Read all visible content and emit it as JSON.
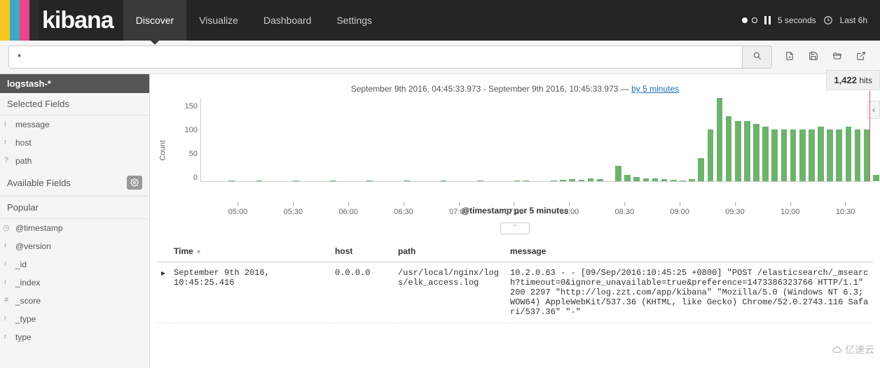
{
  "brand": "kibana",
  "nav": [
    "Discover",
    "Visualize",
    "Dashboard",
    "Settings"
  ],
  "nav_active": 0,
  "interval_label": "5 seconds",
  "timerange_label": "Last 6h",
  "search_value": "*",
  "index_pattern": "logstash-*",
  "hits_count": "1,422",
  "hits_label": "hits",
  "sidebar": {
    "selected_title": "Selected Fields",
    "selected": [
      {
        "type": "t",
        "name": "message"
      },
      {
        "type": "t",
        "name": "host"
      },
      {
        "type": "q",
        "name": "path"
      }
    ],
    "available_title": "Available Fields",
    "popular_title": "Popular",
    "popular": [
      {
        "type": "c",
        "name": "@timestamp"
      },
      {
        "type": "t",
        "name": "@version"
      },
      {
        "type": "t",
        "name": "_id"
      },
      {
        "type": "t",
        "name": "_index"
      },
      {
        "type": "h",
        "name": "_score"
      },
      {
        "type": "t",
        "name": "_type"
      },
      {
        "type": "t",
        "name": "type"
      }
    ]
  },
  "range_from": "September 9th 2016, 04:45:33.973",
  "range_to": "September 9th 2016, 10:45:33.973",
  "range_sep": " - ",
  "range_dash": " — ",
  "range_link": "by 5 minutes",
  "chart_data": {
    "type": "bar",
    "title": "",
    "xlabel": "@timestamp per 5 minutes",
    "ylabel": "Count",
    "ylim": [
      0,
      160
    ],
    "yticks": [
      150,
      100,
      50,
      0
    ],
    "xticks": [
      "05:00",
      "05:30",
      "06:00",
      "06:30",
      "07:00",
      "07:30",
      "08:00",
      "08:30",
      "09:00",
      "09:30",
      "10:00",
      "10:30"
    ],
    "categories_minutes": [
      280,
      285,
      290,
      295,
      300,
      305,
      310,
      315,
      320,
      325,
      330,
      335,
      340,
      345,
      350,
      355,
      360,
      365,
      370,
      375,
      380,
      385,
      390,
      395,
      400,
      405,
      410,
      415,
      420,
      425,
      430,
      435,
      440,
      445,
      450,
      455,
      460,
      465,
      470,
      475,
      480,
      485,
      490,
      495,
      500,
      505,
      510,
      515,
      520,
      525,
      530,
      535,
      540,
      545,
      550,
      555,
      560,
      565,
      570,
      575,
      580,
      585,
      590,
      595,
      600,
      605,
      610,
      615,
      620,
      625,
      630,
      635,
      640,
      645
    ],
    "values": [
      0,
      0,
      0,
      2,
      0,
      0,
      2,
      0,
      0,
      0,
      2,
      0,
      0,
      0,
      2,
      0,
      0,
      0,
      2,
      0,
      0,
      0,
      2,
      0,
      0,
      0,
      2,
      0,
      0,
      0,
      2,
      0,
      0,
      0,
      2,
      2,
      0,
      0,
      2,
      3,
      4,
      3,
      5,
      4,
      0,
      30,
      12,
      8,
      6,
      5,
      4,
      3,
      2,
      4,
      45,
      100,
      160,
      125,
      115,
      115,
      110,
      105,
      100,
      100,
      100,
      100,
      100,
      105,
      100,
      100,
      105,
      100,
      100,
      12
    ]
  },
  "columns": [
    "Time",
    "host",
    "path",
    "message"
  ],
  "row": {
    "time": "September 9th 2016, 10:45:25.416",
    "host": "0.0.0.0",
    "path": "/usr/local/nginx/logs/elk_access.log",
    "message": "10.2.0.63 - - [09/Sep/2016:10:45:25 +0800] \"POST /elasticsearch/_msearch?timeout=0&ignore_unavailable=true&preference=1473386323766 HTTP/1.1\" 200 2297 \"http://log.zzt.com/app/kibana\" \"Mozilla/5.0 (Windows NT 6.3; WOW64) AppleWebKit/537.36 (KHTML, like Gecko) Chrome/52.0.2743.116 Safari/537.36\" \"-\""
  },
  "watermark": "亿速云"
}
